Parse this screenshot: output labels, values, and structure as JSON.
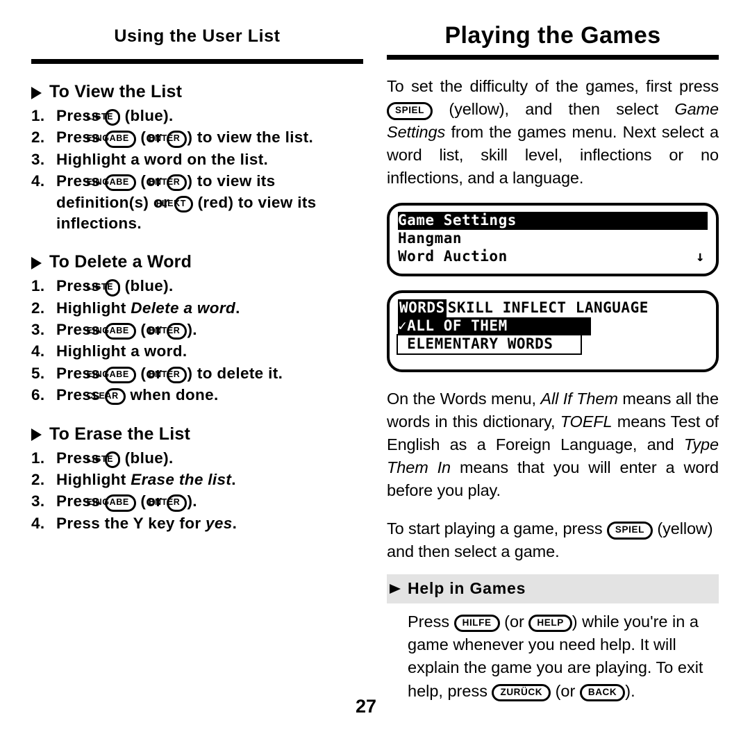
{
  "left": {
    "running_head": "Using the User List",
    "sections": [
      {
        "heading": "To View the List",
        "marker_icon": "triangle-right-icon",
        "steps": [
          {
            "num": "1.",
            "parts": [
              {
                "t": "text",
                "v": "Press "
              },
              {
                "t": "key",
                "v": "LISTE"
              },
              {
                "t": "text",
                "v": " (blue)."
              }
            ]
          },
          {
            "num": "2.",
            "parts": [
              {
                "t": "text",
                "v": "Press "
              },
              {
                "t": "key",
                "v": "EINGABE"
              },
              {
                "t": "text",
                "v": " (or "
              },
              {
                "t": "key",
                "v": "ENTER"
              },
              {
                "t": "text",
                "v": ") to view the list."
              }
            ]
          },
          {
            "num": "3.",
            "parts": [
              {
                "t": "text",
                "v": "Highlight a word on the list."
              }
            ]
          },
          {
            "num": "4.",
            "parts": [
              {
                "t": "text",
                "v": "Press "
              },
              {
                "t": "key",
                "v": "EINGABE"
              },
              {
                "t": "text",
                "v": " (or "
              },
              {
                "t": "key",
                "v": "ENTER"
              },
              {
                "t": "text",
                "v": ") to view its definition(s) or "
              },
              {
                "t": "key",
                "v": "FLEKT"
              },
              {
                "t": "text",
                "v": " (red) to view its inflections."
              }
            ]
          }
        ]
      },
      {
        "heading": "To Delete a Word",
        "marker_icon": "triangle-right-icon",
        "steps": [
          {
            "num": "1.",
            "parts": [
              {
                "t": "text",
                "v": "Press "
              },
              {
                "t": "key",
                "v": "LISTE"
              },
              {
                "t": "text",
                "v": " (blue)."
              }
            ]
          },
          {
            "num": "2.",
            "parts": [
              {
                "t": "text",
                "v": "Highlight "
              },
              {
                "t": "italic",
                "v": "Delete a word"
              },
              {
                "t": "text",
                "v": "."
              }
            ]
          },
          {
            "num": "3.",
            "parts": [
              {
                "t": "text",
                "v": "Press "
              },
              {
                "t": "key",
                "v": "EINGABE"
              },
              {
                "t": "text",
                "v": " (or "
              },
              {
                "t": "key",
                "v": "ENTER"
              },
              {
                "t": "text",
                "v": ")."
              }
            ]
          },
          {
            "num": "4.",
            "parts": [
              {
                "t": "text",
                "v": "Highlight a word."
              }
            ]
          },
          {
            "num": "5.",
            "parts": [
              {
                "t": "text",
                "v": "Press "
              },
              {
                "t": "key",
                "v": "EINGABE"
              },
              {
                "t": "text",
                "v": " (or "
              },
              {
                "t": "key",
                "v": "ENTER"
              },
              {
                "t": "text",
                "v": ") to delete it."
              }
            ]
          },
          {
            "num": "6.",
            "parts": [
              {
                "t": "text",
                "v": "Press "
              },
              {
                "t": "key",
                "v": "CLEAR"
              },
              {
                "t": "text",
                "v": " when done."
              }
            ]
          }
        ]
      },
      {
        "heading": "To Erase the List",
        "marker_icon": "triangle-right-icon",
        "steps": [
          {
            "num": "1.",
            "parts": [
              {
                "t": "text",
                "v": "Press "
              },
              {
                "t": "key",
                "v": "LISTE"
              },
              {
                "t": "text",
                "v": " (blue)."
              }
            ]
          },
          {
            "num": "2.",
            "parts": [
              {
                "t": "text",
                "v": "Highlight "
              },
              {
                "t": "italic",
                "v": "Erase the list"
              },
              {
                "t": "text",
                "v": "."
              }
            ]
          },
          {
            "num": "3.",
            "parts": [
              {
                "t": "text",
                "v": "Press "
              },
              {
                "t": "key",
                "v": "EINGABE"
              },
              {
                "t": "text",
                "v": " (or "
              },
              {
                "t": "key",
                "v": "ENTER"
              },
              {
                "t": "text",
                "v": ")."
              }
            ]
          },
          {
            "num": "4.",
            "parts": [
              {
                "t": "text",
                "v": "Press the Y key for "
              },
              {
                "t": "italic",
                "v": "yes"
              },
              {
                "t": "text",
                "v": "."
              }
            ]
          }
        ]
      }
    ]
  },
  "right": {
    "chapter_title": "Playing the Games",
    "intro_parts": [
      {
        "t": "text",
        "v": "To set the difficulty of the games, first press "
      },
      {
        "t": "key",
        "v": "SPIEL"
      },
      {
        "t": "text",
        "v": " (yellow), and then select "
      },
      {
        "t": "italic",
        "v": "Game Settings"
      },
      {
        "t": "text",
        "v": " from the games menu. Next select a word list, skill level, inflections or no inflections, and a language."
      }
    ],
    "lcd_games_menu": {
      "name": "game-menu-screen",
      "rows": [
        {
          "text": "Game Settings",
          "selected": true,
          "arrow": ""
        },
        {
          "text": "Hangman",
          "selected": false,
          "arrow": ""
        },
        {
          "text": "Word Auction",
          "selected": false,
          "arrow": "↓"
        }
      ]
    },
    "lcd_words_menu": {
      "name": "words-menu-screen",
      "tabs": [
        {
          "label": "WORDS",
          "selected": true
        },
        {
          "label": "SKILL INFLECT LANGUAGE",
          "selected": false
        }
      ],
      "options": [
        {
          "label": "✓ALL OF THEM",
          "selected": true
        },
        {
          "label": " ELEMENTARY WORDS",
          "selected": false
        }
      ]
    },
    "words_par_parts": [
      {
        "t": "text",
        "v": "On the Words menu, "
      },
      {
        "t": "italic",
        "v": "All If Them"
      },
      {
        "t": "text",
        "v": " means all the words in this dictionary, "
      },
      {
        "t": "italic",
        "v": "TOEFL"
      },
      {
        "t": "text",
        "v": " means Test of English as a Foreign Language, and "
      },
      {
        "t": "italic",
        "v": "Type Them In"
      },
      {
        "t": "text",
        "v": " means that you will enter a word before you play."
      }
    ],
    "start_par_parts": [
      {
        "t": "text",
        "v": "To start playing a game, press "
      },
      {
        "t": "key",
        "v": "SPIEL"
      },
      {
        "t": "text",
        "v": " (yellow)  and then select a game."
      }
    ],
    "subhead": "Help in Games",
    "subhead_marker_icon": "arrow-right-icon",
    "help_par_parts": [
      {
        "t": "text",
        "v": "Press "
      },
      {
        "t": "key",
        "v": "HILFE"
      },
      {
        "t": "text",
        "v": " (or "
      },
      {
        "t": "key",
        "v": "HELP"
      },
      {
        "t": "text",
        "v": ") while you're in a game whenever you need help. It will explain the game you are playing. To exit help, press "
      },
      {
        "t": "key",
        "v": "ZURÜCK"
      },
      {
        "t": "text",
        "v": " (or "
      },
      {
        "t": "key",
        "v": "BACK"
      },
      {
        "t": "text",
        "v": ")."
      }
    ]
  },
  "folio": "27",
  "colors": {
    "ink": "#000000",
    "paper": "#ffffff",
    "band": "#e3e3e3"
  }
}
